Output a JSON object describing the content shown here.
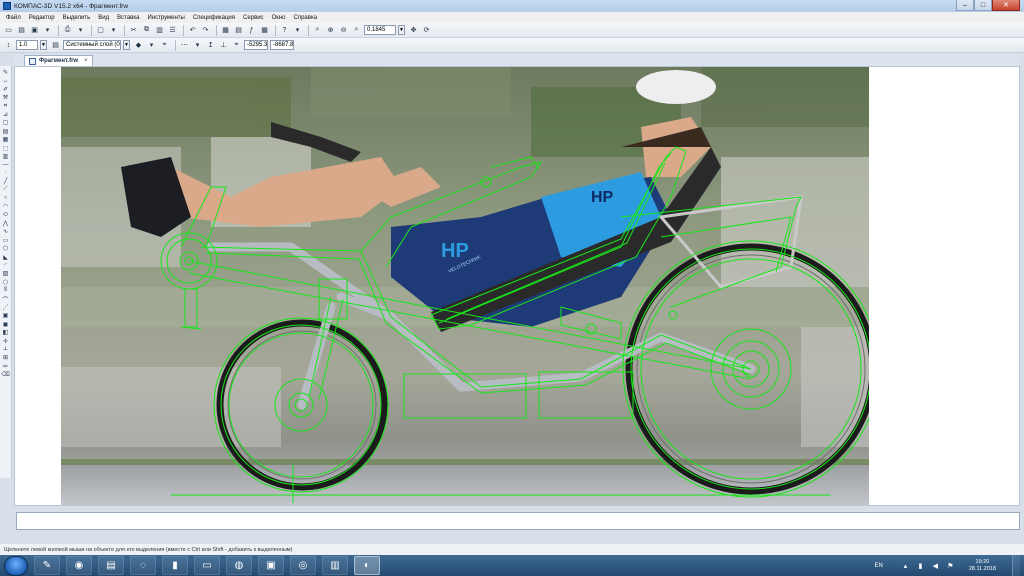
{
  "window": {
    "title": "КОМПАС-3D V15.2  x64 - Фрагмент.frw",
    "minimize": "–",
    "maximize": "□",
    "close": "✕"
  },
  "menu": [
    "Файл",
    "Редактор",
    "Выделить",
    "Вид",
    "Вставка",
    "Инструменты",
    "Спецификация",
    "Сервис",
    "Окно",
    "Справка"
  ],
  "toolbar1": {
    "zoom_value": "0.1845"
  },
  "toolbar2": {
    "step_value": "1.0",
    "layer_value": "Системный слой (0)",
    "coord_x": "-5295.3",
    "coord_y": "-8687.8"
  },
  "document_tab": {
    "label": "Фрагмент.frw",
    "close": "×"
  },
  "photo_text": {
    "jersey_brand": "HP",
    "shorts_brand": "HP",
    "shorts_sub": "VELOTECHNIK"
  },
  "status": {
    "hint": "Щелкните левой кнопкой мыши на объекте для его выделения (вместе с Ctrl или Shift - добавить к выделенным)"
  },
  "taskbar": {
    "language": "EN",
    "time": "19:20",
    "date": "28.11.2018"
  },
  "colors": {
    "drawing_green": "#19e619",
    "title_bg": "#c6daf2",
    "taskbar_bg": "#2f5b85"
  }
}
